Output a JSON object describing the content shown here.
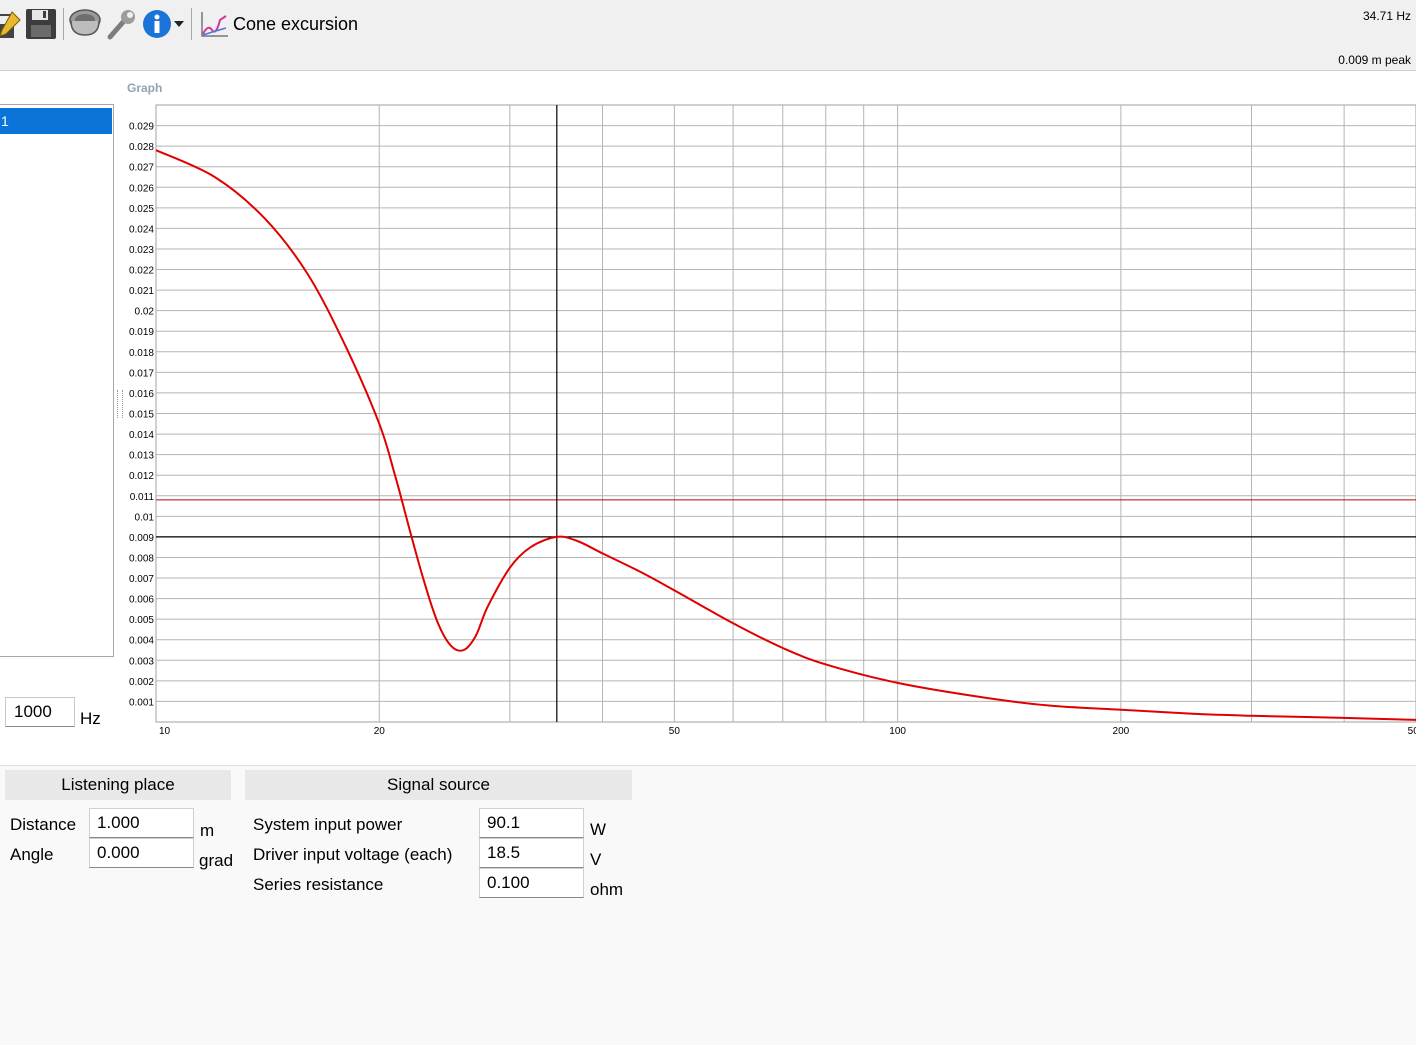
{
  "toolbar": {
    "title": "Cone excursion",
    "readout_frequency": "34.71 Hz",
    "readout_value": "0.009 m peak"
  },
  "graph_label": "Graph",
  "list": {
    "selected_item": "1"
  },
  "frequency_input": {
    "value": "1000",
    "unit": "Hz"
  },
  "colors": {
    "curve": "#e00000",
    "selection": "#0a74d8",
    "limit_line": "#c00000",
    "cursor": "#000000",
    "grid": "#b4b4b4"
  },
  "chart_data": {
    "type": "line",
    "x_scale": "log",
    "xlim": [
      10,
      500
    ],
    "ylim": [
      0,
      0.03
    ],
    "x_ticks": [
      10,
      20,
      50,
      100,
      200,
      500
    ],
    "x_tick_labels": [
      "10",
      "20",
      "50",
      "100",
      "200",
      "500"
    ],
    "y_tick_labels": [
      "0.001",
      "0.002",
      "0.003",
      "0.004",
      "0.005",
      "0.006",
      "0.007",
      "0.008",
      "0.009",
      "0.01",
      "0.011",
      "0.012",
      "0.013",
      "0.014",
      "0.015",
      "0.016",
      "0.017",
      "0.018",
      "0.019",
      "0.02",
      "0.021",
      "0.022",
      "0.023",
      "0.024",
      "0.025",
      "0.026",
      "0.027",
      "0.028",
      "0.029"
    ],
    "grid": true,
    "series": [
      {
        "x": [
          10,
          12,
          14,
          16,
          18,
          20,
          21,
          22,
          23,
          24,
          25,
          26,
          27,
          28,
          30,
          32,
          34.71,
          37,
          40,
          45,
          50,
          60,
          70,
          80,
          100,
          130,
          160,
          200,
          250,
          300,
          400,
          500
        ],
        "y": [
          0.0278,
          0.0265,
          0.0245,
          0.0218,
          0.0183,
          0.0145,
          0.012,
          0.0093,
          0.0068,
          0.0048,
          0.0037,
          0.0035,
          0.0042,
          0.0056,
          0.0075,
          0.0085,
          0.009,
          0.0088,
          0.0082,
          0.0073,
          0.0064,
          0.0048,
          0.0036,
          0.0028,
          0.0019,
          0.0012,
          0.0008,
          0.0006,
          0.0004,
          0.0003,
          0.0002,
          0.0001
        ]
      }
    ],
    "limit_line_y": 0.0108,
    "cursor": {
      "x": 34.71,
      "y": 0.009
    }
  },
  "listening_place": {
    "header": "Listening place",
    "distance": {
      "label": "Distance",
      "value": "1.000",
      "unit": "m"
    },
    "angle": {
      "label": "Angle",
      "value": "0.000",
      "unit": "grad"
    }
  },
  "signal_source": {
    "header": "Signal source",
    "power": {
      "label": "System input power",
      "value": "90.1",
      "unit": "W"
    },
    "voltage": {
      "label": "Driver input voltage (each)",
      "value": "18.5",
      "unit": "V"
    },
    "resistance": {
      "label": "Series resistance",
      "value": "0.100",
      "unit": "ohm"
    }
  }
}
